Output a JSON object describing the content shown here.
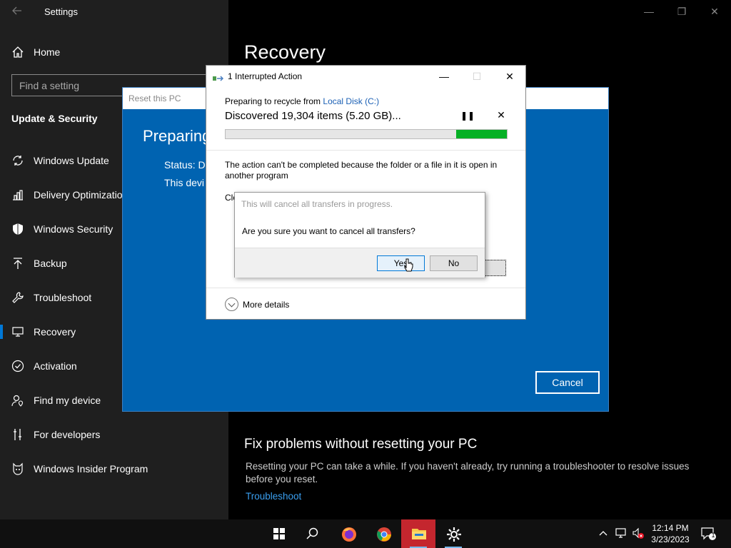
{
  "settings": {
    "app_title": "Settings",
    "home_label": "Home",
    "search_placeholder": "Find a setting",
    "section_title": "Update & Security",
    "nav_items": [
      {
        "label": "Windows Update",
        "icon": "sync-icon"
      },
      {
        "label": "Delivery Optimizatio",
        "icon": "delivery-optimization-icon"
      },
      {
        "label": "Windows Security",
        "icon": "shield-icon"
      },
      {
        "label": "Backup",
        "icon": "backup-arrow-icon"
      },
      {
        "label": "Troubleshoot",
        "icon": "wrench-icon"
      },
      {
        "label": "Recovery",
        "icon": "recovery-icon",
        "active": true
      },
      {
        "label": "Activation",
        "icon": "check-circle-icon"
      },
      {
        "label": "Find my device",
        "icon": "person-location-icon"
      },
      {
        "label": "For developers",
        "icon": "developer-tools-icon"
      },
      {
        "label": "Windows Insider Program",
        "icon": "insider-cat-icon"
      }
    ]
  },
  "main": {
    "page_title": "Recovery",
    "fix_title": "Fix problems without resetting your PC",
    "fix_desc": "Resetting your PC can take a while. If you haven't already, try running a troubleshooter to resolve issues before you reset.",
    "fix_link": "Troubleshoot"
  },
  "reset_window": {
    "title": "Reset this PC",
    "heading": "Preparing",
    "status": "Status: D",
    "device": "This devi",
    "cancel_label": "Cancel"
  },
  "op_dialog": {
    "title": "1 Interrupted Action",
    "preparing_prefix": "Preparing to recycle from ",
    "preparing_link": "Local Disk (C:)",
    "discovered": "Discovered 19,304 items (5.20 GB)...",
    "progress_fraction": 0.82,
    "message": "The action can't be completed because the folder or a file in it is open in another program",
    "close_partial": "Clo",
    "more_details": "More details"
  },
  "confirm_dialog": {
    "title": "This will cancel all transfers in progress.",
    "question": "Are you sure you want to cancel all transfers?",
    "yes_label": "Yes",
    "no_label": "No"
  },
  "taskbar": {
    "apps": [
      "start-icon",
      "search-icon",
      "firefox-icon",
      "chrome-icon",
      "file-explorer-icon",
      "settings-gear-icon"
    ],
    "time": "12:14 PM",
    "date": "3/23/2023",
    "notification_count": "1"
  },
  "colors": {
    "accent": "#0078d7",
    "reset_blue": "#0063b1",
    "progress_green": "#06b025",
    "link": "#3a9ff0"
  }
}
